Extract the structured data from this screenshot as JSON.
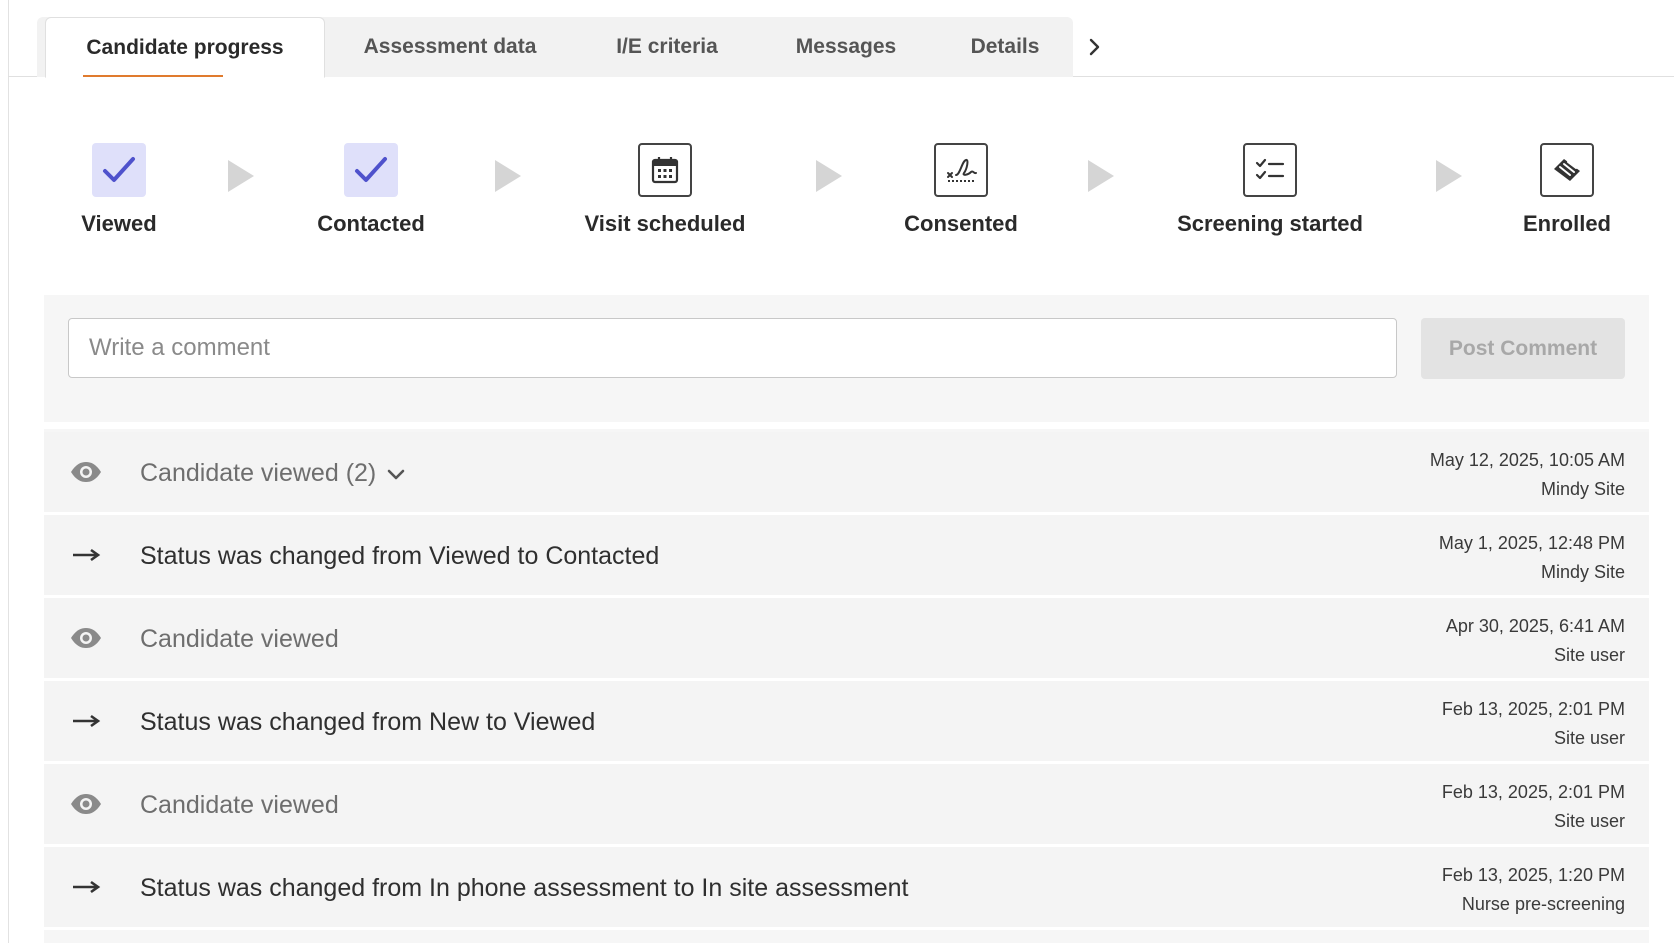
{
  "tabs": {
    "items": [
      {
        "label": "Candidate progress",
        "active": true
      },
      {
        "label": "Assessment data"
      },
      {
        "label": "I/E criteria"
      },
      {
        "label": "Messages"
      },
      {
        "label": "Details"
      }
    ],
    "more_icon": "chevron-right-icon"
  },
  "steps": [
    {
      "label": "Viewed",
      "state": "done",
      "icon": "check-icon"
    },
    {
      "label": "Contacted",
      "state": "done",
      "icon": "check-icon"
    },
    {
      "label": "Visit scheduled",
      "state": "pending",
      "icon": "calendar-icon"
    },
    {
      "label": "Consented",
      "state": "pending",
      "icon": "signature-icon"
    },
    {
      "label": "Screening started",
      "state": "pending",
      "icon": "checklist-icon"
    },
    {
      "label": "Enrolled",
      "state": "pending",
      "icon": "handshake-icon"
    }
  ],
  "comment": {
    "placeholder": "Write a comment",
    "value": "",
    "post_label": "Post Comment"
  },
  "activity": [
    {
      "type": "view",
      "text": "Candidate viewed (2)",
      "expandable": true,
      "date": "May 12, 2025, 10:05 AM",
      "user": "Mindy Site"
    },
    {
      "type": "status",
      "text": "Status was changed from Viewed to Contacted",
      "date": "May 1, 2025, 12:48 PM",
      "user": "Mindy Site"
    },
    {
      "type": "view",
      "text": "Candidate viewed",
      "date": "Apr 30, 2025, 6:41 AM",
      "user": "Site user"
    },
    {
      "type": "status",
      "text": "Status was changed from New to Viewed",
      "date": "Feb 13, 2025, 2:01 PM",
      "user": "Site user"
    },
    {
      "type": "view",
      "text": "Candidate viewed",
      "date": "Feb 13, 2025, 2:01 PM",
      "user": "Site user"
    },
    {
      "type": "status",
      "text": "Status was changed from In phone assessment to In site assessment",
      "date": "Feb 13, 2025, 1:20 PM",
      "user": "Nurse pre-screening"
    }
  ],
  "colors": {
    "accent_underline": "#e07b2e",
    "step_done_bg": "#dfe0fa",
    "step_check": "#4f52cc",
    "button_disabled_bg": "#e3e3e3"
  }
}
